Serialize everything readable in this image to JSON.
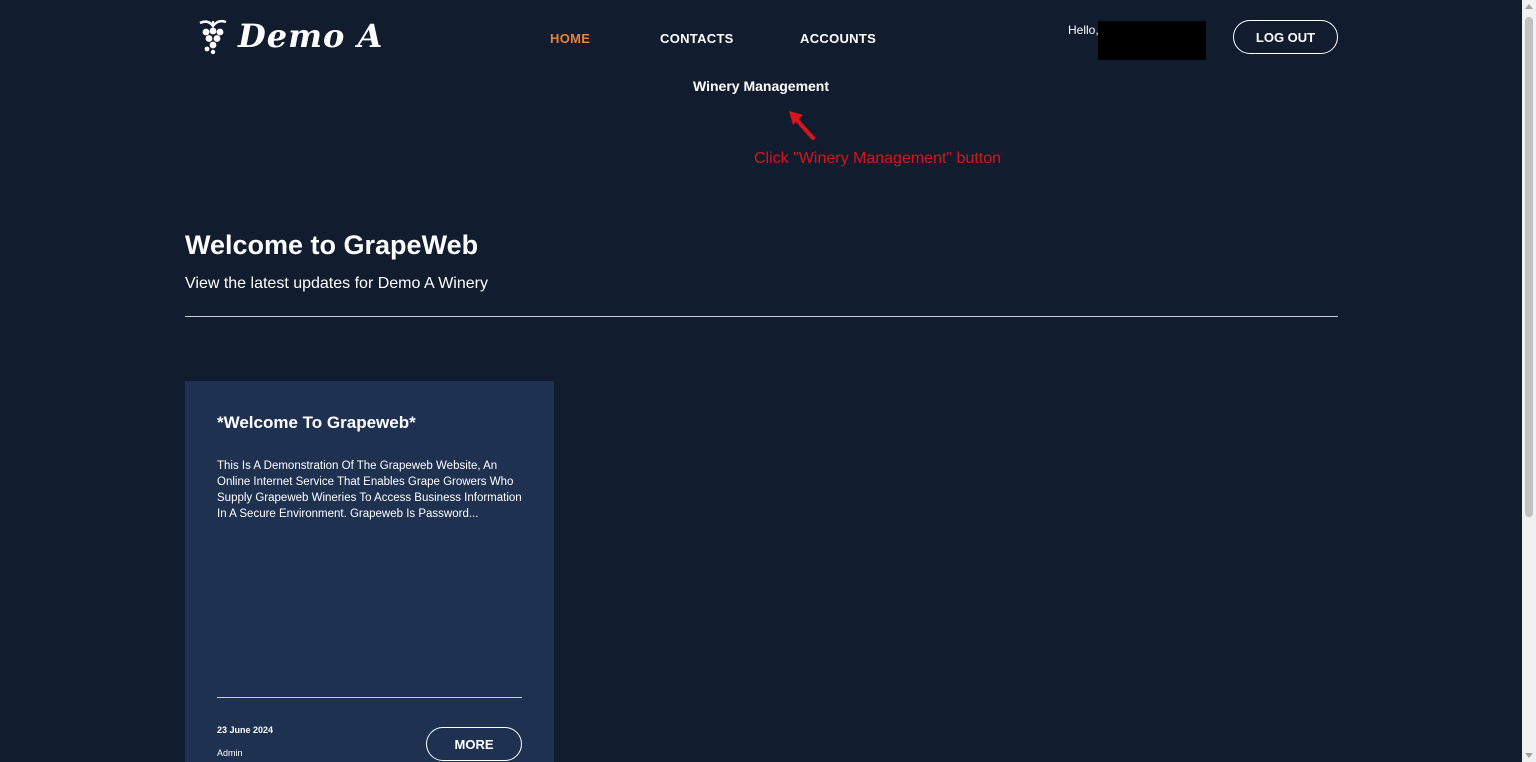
{
  "header": {
    "logo_text": "Demo A",
    "logo_icon": "grape-icon",
    "nav": {
      "home": "HOME",
      "contacts": "CONTACTS",
      "accounts": "ACCOUNTS"
    },
    "active_nav_color": "#e8823a",
    "subnav_label": "Winery Management",
    "hello_text": "Hello,",
    "logout_label": "LOG OUT"
  },
  "annotation": {
    "text": "Click \"Winery Management\" button",
    "color": "#d6151d"
  },
  "main": {
    "title": "Welcome to GrapeWeb",
    "subtitle": "View the latest updates for Demo A Winery"
  },
  "card": {
    "title": "*Welcome To Grapeweb*",
    "body": "This Is A Demonstration Of The Grapeweb Website, An Online Internet Service That Enables Grape Growers Who Supply Grapeweb Wineries To Access Business Information In A Secure Environment. Grapeweb Is Password...",
    "date": "23 June 2024",
    "author": "Admin",
    "more_label": "MORE"
  },
  "colors": {
    "background": "#121c2f",
    "card": "#1e3150"
  }
}
